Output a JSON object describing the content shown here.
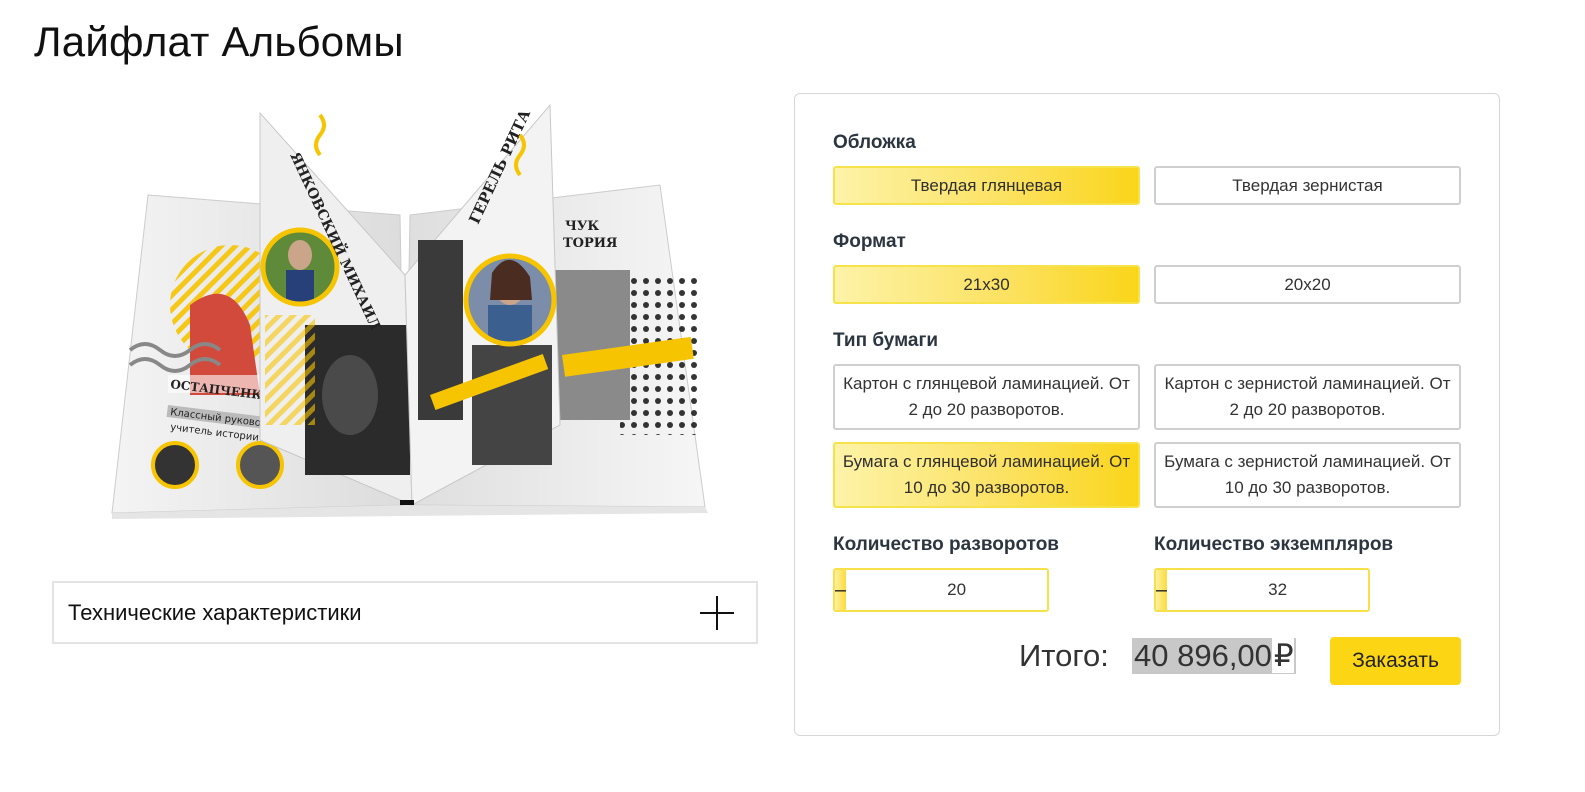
{
  "page": {
    "title": "Лайфлат Альбомы"
  },
  "specs": {
    "label": "Технические характеристики",
    "icon": "plus-icon"
  },
  "cover": {
    "title": "Обложка",
    "options": [
      "Твердая глянцевая",
      "Твердая зернистая"
    ],
    "selected": "Твердая глянцевая"
  },
  "format": {
    "title": "Формат",
    "options": [
      "21x30",
      "20x20"
    ],
    "selected": "21x30"
  },
  "paper": {
    "title": "Тип бумаги",
    "options": [
      "Картон с глянцевой ламинацией. От 2 до 20 разворотов.",
      "Картон с зернистой ламинацией. От 2 до 20 разворотов.",
      "Бумага с глянцевой ламинацией. От 10 до 30 разворотов.",
      "Бумага с зернистой ламинацией. От 10 до 30 разворотов."
    ],
    "selected": "Бумага с глянцевой ламинацией. От 10 до 30 разворотов."
  },
  "spreads": {
    "title": "Количество разворотов",
    "minus": "–",
    "plus": "+",
    "value": "20"
  },
  "copies": {
    "title": "Количество экземпляров",
    "minus": "–",
    "plus": "+",
    "value": "32"
  },
  "total": {
    "label": "Итого:",
    "value": "40 896,00",
    "currency": "₽"
  },
  "order_button": "Заказать",
  "colors": {
    "accent": "#fcd515",
    "accent_light": "#fdf3a8",
    "border": "#cfcfcf",
    "heading": "#2c3640"
  },
  "product_image": {
    "name_cover": "ЯНКОВСКИЙ МИХАИЛ",
    "name_right": "ГЕРЕЛЬ РИТА",
    "teacher_name": "ОСТАПЧЕНКО ТАТЬЯНА МИХАЙЛОВНА",
    "teacher_role": "Классный руководитель,",
    "teacher_subject": "учитель истории"
  }
}
